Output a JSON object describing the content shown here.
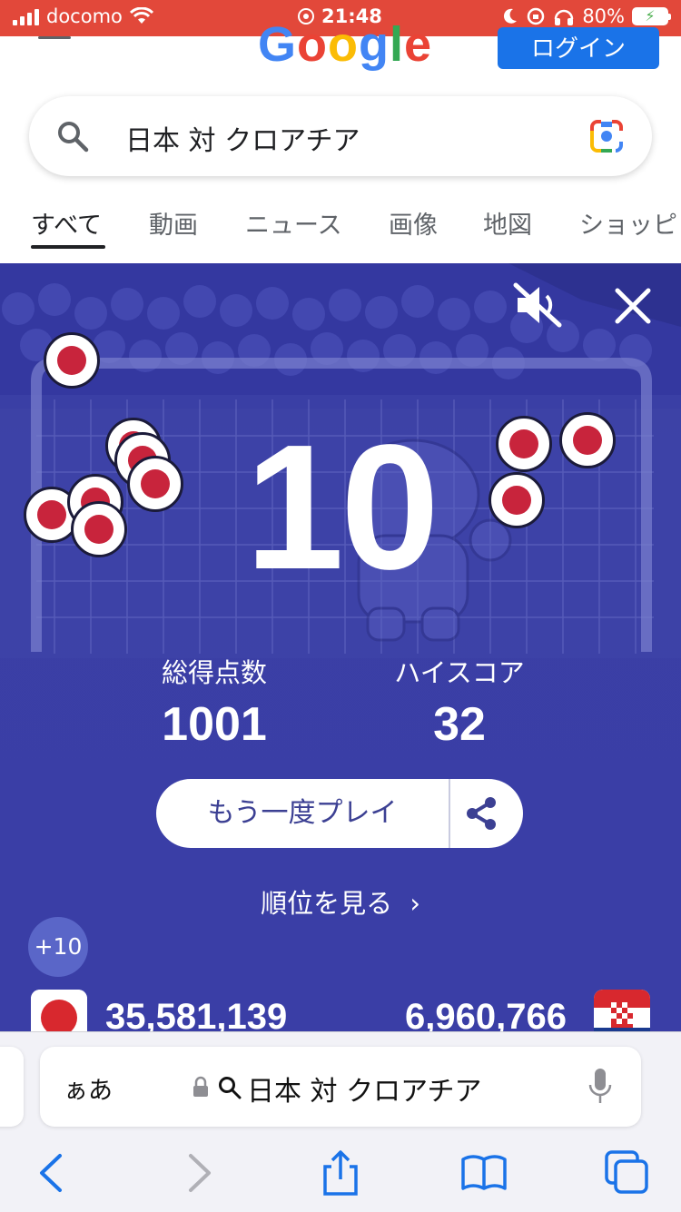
{
  "status_bar": {
    "carrier": "docomo",
    "time": "21:48",
    "battery": "80%"
  },
  "header": {
    "logo": "Google",
    "login_label": "ログイン"
  },
  "search": {
    "query": "日本 対 クロアチア"
  },
  "tabs": [
    {
      "label": "すべて",
      "active": true
    },
    {
      "label": "動画"
    },
    {
      "label": "ニュース"
    },
    {
      "label": "画像"
    },
    {
      "label": "地図"
    },
    {
      "label": "ショッピ"
    }
  ],
  "game": {
    "score": "10",
    "total_label": "総得点数",
    "total_value": "1001",
    "high_label": "ハイスコア",
    "high_value": "32",
    "play_again_label": "もう一度プレイ",
    "ranking_label": "順位を見る",
    "ranking_chevron": "›",
    "plus_badge": "+10",
    "team_left_score": "35,581,139",
    "team_right_score": "6,960,766",
    "team_left_flag": "japan-flag",
    "team_right_flag": "croatia-flag"
  },
  "safari": {
    "aa_label": "ぁあ",
    "address": "日本 対 クロアチア"
  },
  "colors": {
    "status_bar": "#e2483a",
    "game_bg": "#3a3ea6",
    "accent_blue": "#1a73e8",
    "ball_red": "#c8243c"
  }
}
